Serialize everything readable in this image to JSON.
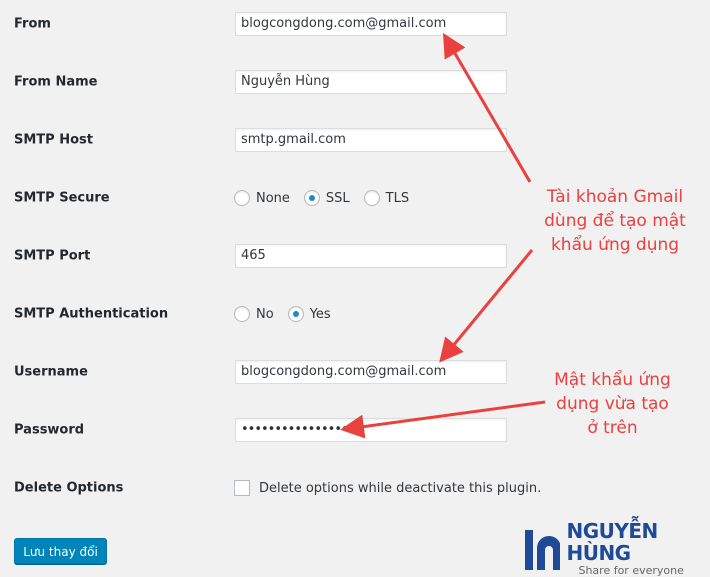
{
  "fields": [
    {
      "label": "From",
      "value": "blogcongdong.com@gmail.com"
    },
    {
      "label": "From Name",
      "value": "Nguyễn Hùng"
    },
    {
      "label": "SMTP Host",
      "value": "smtp.gmail.com"
    },
    {
      "label": "SMTP Secure",
      "options": [
        "None",
        "SSL",
        "TLS"
      ],
      "selected": "SSL"
    },
    {
      "label": "SMTP Port",
      "value": "465"
    },
    {
      "label": "SMTP Authentication",
      "options": [
        "No",
        "Yes"
      ],
      "selected": "Yes"
    },
    {
      "label": "Username",
      "value": "blogcongdong.com@gmail.com"
    },
    {
      "label": "Password",
      "value": "••••••••••••••••"
    },
    {
      "label": "Delete Options",
      "checkbox_label": "Delete options while deactivate this plugin.",
      "checked": false
    }
  ],
  "save_label": "Lưu thay đổi",
  "annotations": {
    "note1": [
      "Tài khoản Gmail",
      "dùng để tạo mật",
      "khẩu ứng dụng"
    ],
    "note2": [
      "Mật khẩu ứng",
      "dụng vừa tạo",
      "ở trên"
    ],
    "color": "#e8413e"
  },
  "logo": {
    "name": "NGUYỄN HÙNG",
    "tagline": "Share for everyone",
    "color": "#1f4a98"
  }
}
